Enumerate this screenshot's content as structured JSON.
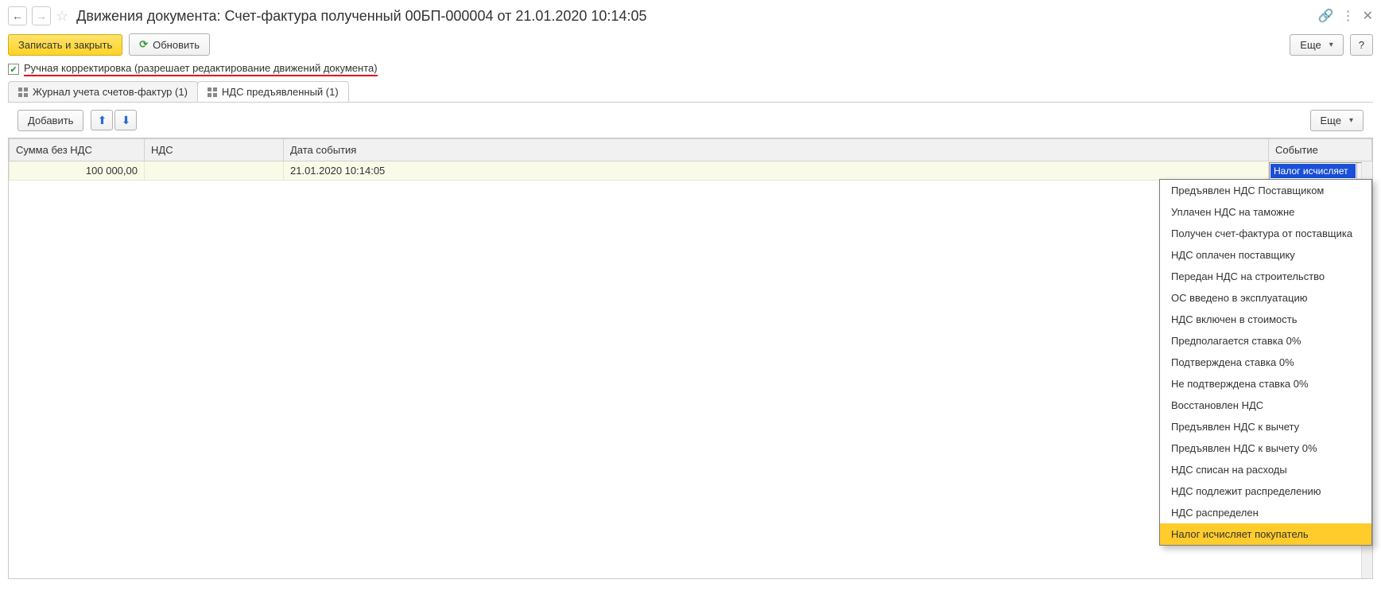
{
  "header": {
    "title": "Движения документа: Счет-фактура полученный 00БП-000004 от 21.01.2020 10:14:05"
  },
  "toolbar": {
    "save_close": "Записать и закрыть",
    "refresh": "Обновить",
    "more": "Еще",
    "help": "?"
  },
  "checkbox": {
    "label": "Ручная корректировка (разрешает редактирование движений документа)"
  },
  "tabs": [
    {
      "label": "Журнал учета счетов-фактур (1)"
    },
    {
      "label": "НДС предъявленный (1)"
    }
  ],
  "subtoolbar": {
    "add": "Добавить",
    "more": "Еще"
  },
  "columns": {
    "sum": "Сумма без НДС",
    "nds": "НДС",
    "date": "Дата события",
    "event": "Событие"
  },
  "row": {
    "sum": "100 000,00",
    "nds": "",
    "date": "21.01.2020 10:14:05",
    "event": "Налог исчисляет"
  },
  "dropdown": {
    "items": [
      "Предъявлен НДС Поставщиком",
      "Уплачен НДС на таможне",
      "Получен счет-фактура от поставщика",
      "НДС оплачен поставщику",
      "Передан НДС на строительство",
      "ОС введено в эксплуатацию",
      "НДС включен в стоимость",
      "Предполагается ставка 0%",
      "Подтверждена ставка 0%",
      "Не подтверждена ставка 0%",
      "Восстановлен НДС",
      "Предъявлен НДС к вычету",
      "Предъявлен НДС к вычету 0%",
      "НДС списан на расходы",
      "НДС подлежит распределению",
      "НДС распределен",
      "Налог исчисляет покупатель"
    ],
    "selected_index": 16
  }
}
